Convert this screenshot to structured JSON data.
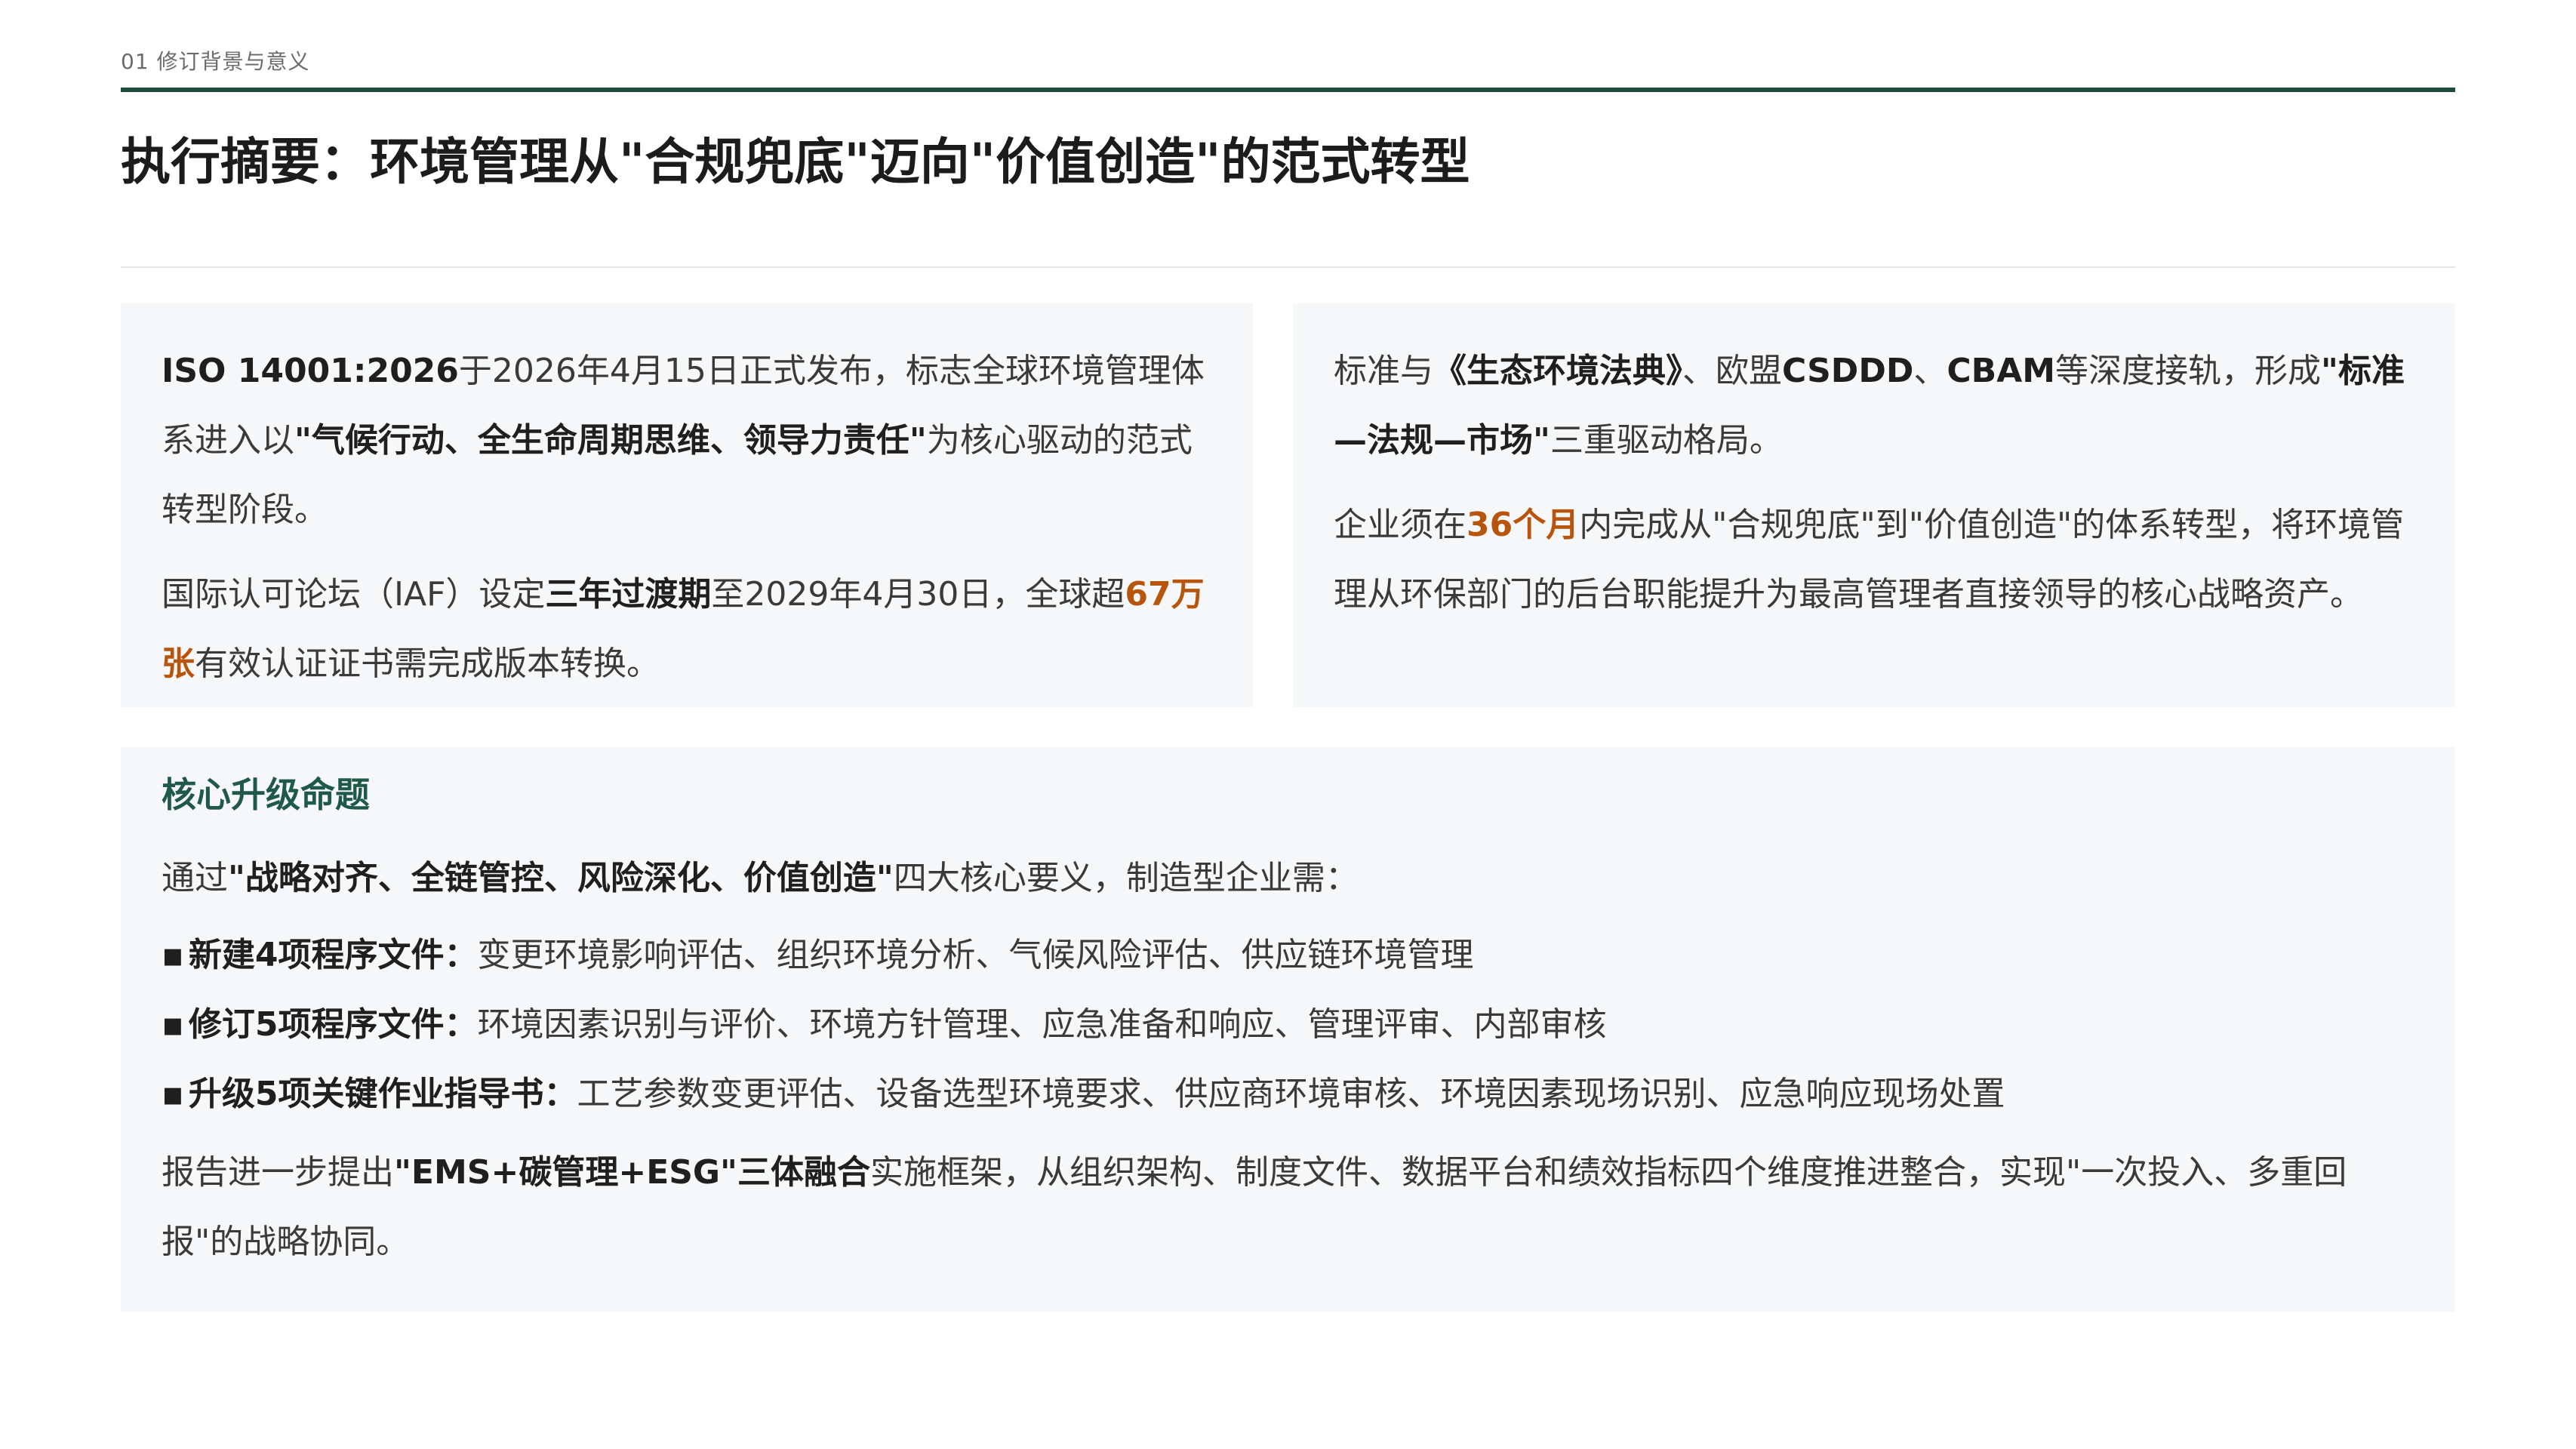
{
  "header": {
    "section_label": "01 修订背景与意义",
    "title": "执行摘要：环境管理从\"合规兜底\"迈向\"价值创造\"的范式转型"
  },
  "left_card": {
    "p1": {
      "t1": "ISO 14001:2026",
      "t2": "于2026年4月15日正式发布，标志全球环境管理体系进入以",
      "t3": "\"气候行动、全生命周期思维、领导力责任\"",
      "t4": "为核心驱动的范式转型阶段。"
    },
    "p2": {
      "t1": "国际认可论坛（IAF）设定",
      "t2": "三年过渡期",
      "t3": "至2029年4月30日，全球超",
      "t4": "67万张",
      "t5": "有效认证证书需完成版本转换。"
    }
  },
  "right_card": {
    "p1": {
      "t1": "标准与",
      "t2": "《生态环境法典》",
      "t3": "、欧盟",
      "t4": "CSDDD",
      "t5": "、",
      "t6": "CBAM",
      "t7": "等深度接轨，形成",
      "t8": "\"标准—法规—市场\"",
      "t9": "三重驱动格局。"
    },
    "p2": {
      "t1": "企业须在",
      "t2": "36个月",
      "t3": "内完成从\"合规兜底\"到\"价值创造\"的体系转型，将环境管理从环保部门的后台职能提升为最高管理者直接领导的核心战略资产。"
    }
  },
  "bottom_card": {
    "heading": "核心升级命题",
    "intro": {
      "t1": "通过",
      "t2": "\"战略对齐、全链管控、风险深化、价值创造\"",
      "t3": "四大核心要义，制造型企业需："
    },
    "bullets": [
      {
        "mark": "▪",
        "label": "新建4项程序文件：",
        "text": "变更环境影响评估、组织环境分析、气候风险评估、供应链环境管理"
      },
      {
        "mark": "▪",
        "label": "修订5项程序文件：",
        "text": "环境因素识别与评价、环境方针管理、应急准备和响应、管理评审、内部审核"
      },
      {
        "mark": "▪",
        "label": "升级5项关键作业指导书：",
        "text": "工艺参数变更评估、设备选型环境要求、供应商环境审核、环境因素现场识别、应急响应现场处置"
      }
    ],
    "closing": {
      "t1": "报告进一步提出",
      "t2": "\"EMS+碳管理+ESG\"三体融合",
      "t3": "实施框架，从组织架构、制度文件、数据平台和绩效指标四个维度推进整合，实现\"一次投入、多重回报\"的战略协同。"
    }
  }
}
